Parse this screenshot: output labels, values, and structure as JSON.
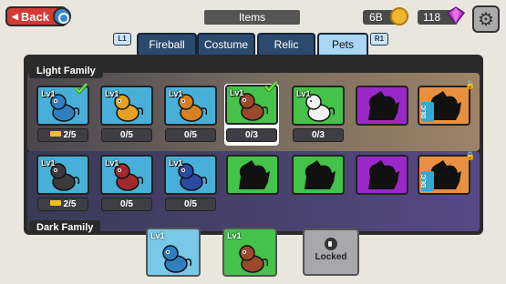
{
  "header": {
    "back_label": "Back",
    "title": "Items",
    "coins": "6B",
    "gems": "118"
  },
  "tabs": {
    "left_key": "L1",
    "right_key": "R1",
    "items": [
      {
        "label": "Fireball",
        "active": false
      },
      {
        "label": "Costume",
        "active": false
      },
      {
        "label": "Relic",
        "active": false
      },
      {
        "label": "Pets",
        "active": true
      }
    ]
  },
  "light_family": {
    "label": "Light Family",
    "pets": [
      {
        "level": "Lv1",
        "count": "2/5",
        "owned": true,
        "equipped": true,
        "color": "#48b0d8",
        "creature": "#2f7fc0"
      },
      {
        "level": "Lv1",
        "count": "0/5",
        "owned": true,
        "equipped": false,
        "color": "#48b0d8",
        "creature": "#e8a020"
      },
      {
        "level": "Lv1",
        "count": "0/5",
        "owned": true,
        "equipped": false,
        "color": "#48b0d8",
        "creature": "#d88020"
      },
      {
        "level": "Lv1",
        "count": "0/3",
        "owned": true,
        "equipped": true,
        "selected": true,
        "color": "#44c24a",
        "creature": "#9a4a2a"
      },
      {
        "level": "Lv1",
        "count": "0/3",
        "owned": true,
        "equipped": false,
        "color": "#44c24a",
        "creature": "#f2f2f2"
      },
      {
        "locked_silhouette": true,
        "color": "#9a28c8"
      },
      {
        "locked_silhouette": true,
        "color": "#e89040",
        "dlc": "DLC"
      }
    ]
  },
  "dark_family": {
    "label": "Dark Family",
    "pets": [
      {
        "level": "Lv1",
        "count": "2/5",
        "owned": true,
        "equipped": false,
        "color": "#48b0d8",
        "creature": "#3a3a3a"
      },
      {
        "level": "Lv1",
        "count": "0/5",
        "owned": true,
        "equipped": false,
        "color": "#48b0d8",
        "creature": "#a02a2a"
      },
      {
        "level": "Lv1",
        "count": "0/5",
        "owned": true,
        "equipped": false,
        "color": "#48b0d8",
        "creature": "#2a4aa0"
      },
      {
        "locked_silhouette": true,
        "color": "#44c24a"
      },
      {
        "locked_silhouette": true,
        "color": "#44c24a"
      },
      {
        "locked_silhouette": true,
        "color": "#9a28c8"
      },
      {
        "locked_silhouette": true,
        "color": "#e89040",
        "dlc": "DLC"
      }
    ]
  },
  "equipped_slots": [
    {
      "level": "Lv1",
      "color": "#78c8e8",
      "creature": "#2f7fc0"
    },
    {
      "level": "Lv1",
      "color": "#44c24a",
      "creature": "#9a4a2a"
    },
    {
      "label": "Locked"
    }
  ],
  "icons": {
    "back": "back-arrow-icon",
    "coin": "coin-icon",
    "gem": "gem-icon",
    "settings": "gear-icon",
    "check": "checkmark-icon",
    "lock": "lock-icon"
  },
  "colors": {
    "tab_active": "#a8d6f4",
    "tab_inactive": "#2c4a6e",
    "back_button": "#d43a34"
  }
}
